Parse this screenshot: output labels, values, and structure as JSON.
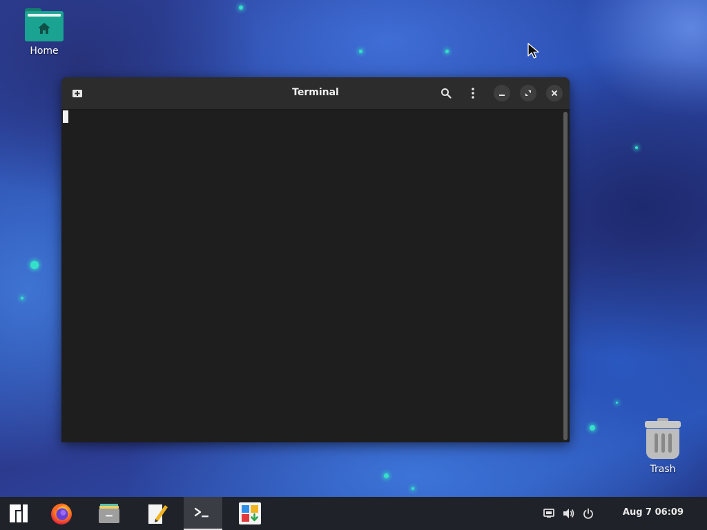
{
  "desktop": {
    "home_label": "Home",
    "trash_label": "Trash"
  },
  "window": {
    "title": "Terminal",
    "buttons": {
      "new_tab": "new-tab-icon",
      "search": "search-icon",
      "menu": "kebab-menu-icon",
      "minimize": "minimize-icon",
      "maximize": "maximize-icon",
      "close": "close-icon"
    }
  },
  "taskbar": {
    "apps": [
      {
        "name": "Application menu",
        "icon": "manjaro-logo-icon"
      },
      {
        "name": "Firefox",
        "icon": "firefox-icon"
      },
      {
        "name": "Files",
        "icon": "files-icon"
      },
      {
        "name": "Text Editor",
        "icon": "text-editor-icon"
      },
      {
        "name": "Terminal",
        "icon": "terminal-icon",
        "active": true
      },
      {
        "name": "Software",
        "icon": "software-center-icon"
      }
    ],
    "tray": {
      "network_icon": "network-wired-icon",
      "volume_icon": "volume-icon",
      "power_icon": "power-icon"
    },
    "clock": "Aug 7  06:09"
  },
  "colors": {
    "accent_teal": "#1aa391",
    "headerbar": "#2c2c2c",
    "terminal_bg": "#1e1e1e",
    "taskbar_bg": "#1f2228"
  }
}
